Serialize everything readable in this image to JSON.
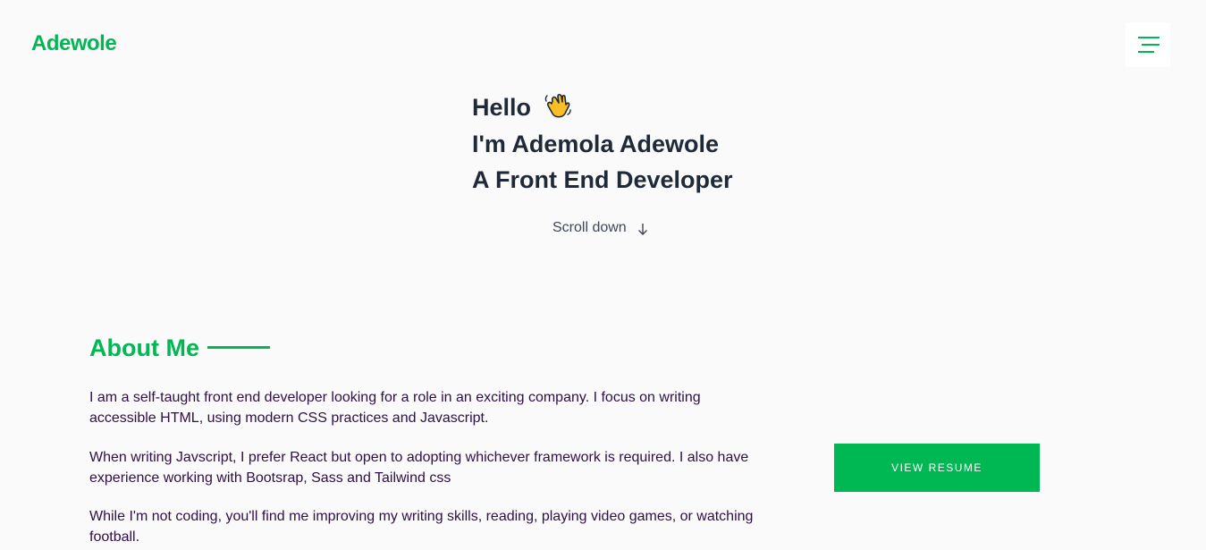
{
  "brand": {
    "logo_text": "Adewole",
    "accent_color": "#00b853",
    "text_color": "#1f2937",
    "body_text_color": "#2e1046",
    "background_color": "#fafafa"
  },
  "header": {
    "menu_icon": "hamburger-menu-icon"
  },
  "hero": {
    "greeting": "Hello",
    "greeting_icon": "waving-hand-icon",
    "name_line": "I'm Ademola Adewole",
    "role_line": "A Front End Developer",
    "scroll_label": "Scroll down",
    "scroll_icon": "arrow-down-icon"
  },
  "about": {
    "heading": "About Me",
    "paragraphs": [
      "I am a self-taught front end developer looking for a role in an exciting company. I focus on writing accessible HTML, using modern CSS practices and Javascript.",
      "When writing Javscript, I prefer React but open to adopting whichever framework is required. I also have experience working with Bootsrap, Sass and Tailwind css",
      "While I'm not coding, you'll find me improving my writing skills, reading, playing video games, or watching football."
    ],
    "resume_button_label": "View Resume"
  }
}
